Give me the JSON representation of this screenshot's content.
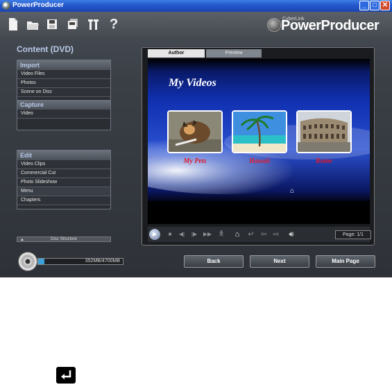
{
  "window": {
    "title": "PowerProducer",
    "controls": {
      "minimize": "_",
      "maximize": "□",
      "close": "✕"
    }
  },
  "toolbar": {
    "icons": [
      "new-file-icon",
      "open-folder-icon",
      "save-icon",
      "save-as-icon",
      "settings-tools-icon",
      "help-icon"
    ],
    "help_label": "?",
    "brand_small": "CyberLink",
    "brand_name": "PowerProducer"
  },
  "left_panel": {
    "title": "Content (DVD)",
    "import": {
      "header": "Import",
      "items": [
        "Video Files",
        "Photos",
        "Scene on Disc"
      ]
    },
    "capture": {
      "header": "Capture",
      "items": [
        "Video"
      ]
    },
    "edit": {
      "header": "Edit",
      "items": [
        "Video Clips",
        "Commercial Cut",
        "Photo Slideshow",
        "Menu",
        "Chapters"
      ]
    },
    "disc_structure": "Disc Structure"
  },
  "preview": {
    "tabs": {
      "author": "Author",
      "preview": "Preview"
    },
    "menu_title": "My Videos",
    "thumbnails": [
      {
        "label": "My Pets"
      },
      {
        "label": "Hawaii"
      },
      {
        "label": "Rome"
      }
    ],
    "page": "Page: 1/1"
  },
  "bottom": {
    "capacity_text": "352MB/4700MB",
    "capacity_fraction": 0.075,
    "back": "Back",
    "next": "Next",
    "main_page": "Main Page"
  },
  "colors": {
    "titlebar": "#2457cc",
    "panel_accent": "#b8c8e8",
    "thumb_label": "#e0182a",
    "capacity_fill": "#3fa1d9"
  }
}
